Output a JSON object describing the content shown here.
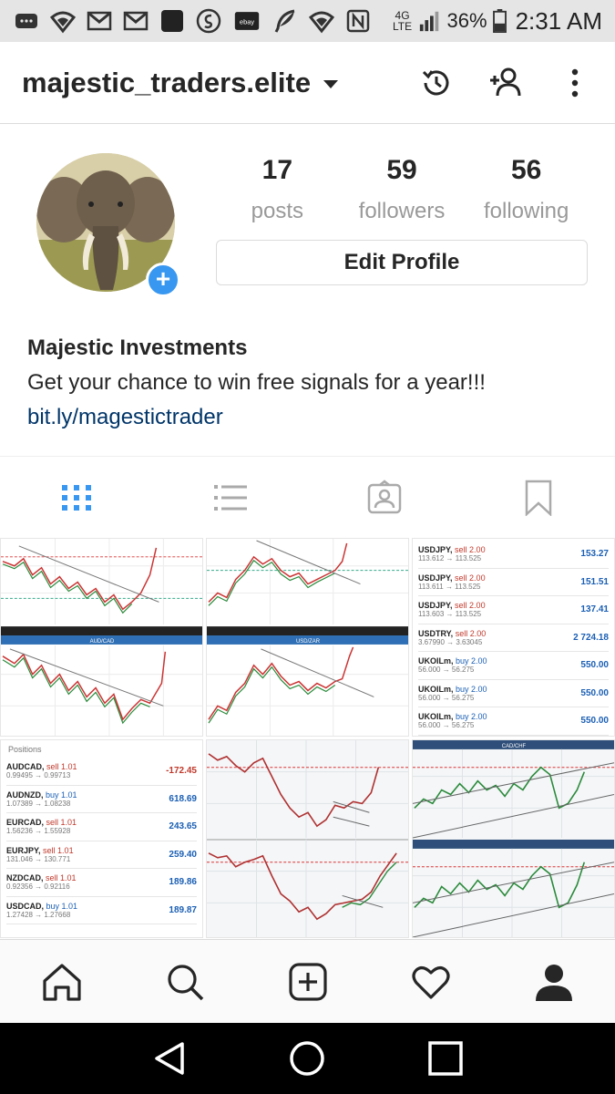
{
  "status_bar": {
    "left_icons": [
      "message-icon",
      "wifi-icon",
      "gmail-icon",
      "gmail-icon",
      "square-app-icon",
      "shazam-icon",
      "ebay-icon",
      "feather-icon",
      "wifi-icon",
      "nfc-icon"
    ],
    "ebay_label": "ebay",
    "network": "4G LTE",
    "battery": "36%",
    "time": "2:31 AM"
  },
  "header": {
    "username": "majestic_traders.elite",
    "icons": [
      "history-icon",
      "add-person-icon",
      "more-vertical-icon"
    ]
  },
  "profile": {
    "stats": [
      {
        "value": "17",
        "label": "posts"
      },
      {
        "value": "59",
        "label": "followers"
      },
      {
        "value": "56",
        "label": "following"
      }
    ],
    "edit_button": "Edit Profile",
    "bio_name": "Majestic Investments",
    "bio_text": "Get your chance to win free signals for a year!!!",
    "bio_link": "bit.ly/magestictrader"
  },
  "tabs": [
    "grid-icon",
    "list-icon",
    "tagged-icon",
    "bookmark-icon"
  ],
  "posts": {
    "trades_top": [
      {
        "sym": "USDJPY,",
        "act": "sell 2.00",
        "side": "sell",
        "px": "113.612 → 113.525",
        "val": "153.27"
      },
      {
        "sym": "USDJPY,",
        "act": "sell 2.00",
        "side": "sell",
        "px": "113.611 → 113.525",
        "val": "151.51"
      },
      {
        "sym": "USDJPY,",
        "act": "sell 2.00",
        "side": "sell",
        "px": "113.603 → 113.525",
        "val": "137.41"
      },
      {
        "sym": "USDTRY,",
        "act": "sell 2.00",
        "side": "sell",
        "px": "3.67990 → 3.63045",
        "val": "2 724.18"
      },
      {
        "sym": "UKOILm,",
        "act": "buy 2.00",
        "side": "buy",
        "px": "56.000 → 56.275",
        "val": "550.00"
      },
      {
        "sym": "UKOILm,",
        "act": "buy 2.00",
        "side": "buy",
        "px": "56.000 → 56.275",
        "val": "550.00"
      },
      {
        "sym": "UKOILm,",
        "act": "buy 2.00",
        "side": "buy",
        "px": "56.000 → 56.275",
        "val": "550.00"
      }
    ],
    "positions_header": "Positions",
    "trades_positions": [
      {
        "sym": "AUDCAD,",
        "act": "sell 1.01",
        "side": "sell",
        "px": "0.99495 → 0.99713",
        "val": "-172.45",
        "neg": true
      },
      {
        "sym": "AUDNZD,",
        "act": "buy 1.01",
        "side": "buy",
        "px": "1.07389 → 1.08238",
        "val": "618.69",
        "neg": false
      },
      {
        "sym": "EURCAD,",
        "act": "sell 1.01",
        "side": "sell",
        "px": "1.56236 → 1.55928",
        "val": "243.65",
        "neg": false
      },
      {
        "sym": "EURJPY,",
        "act": "sell 1.01",
        "side": "sell",
        "px": "131.046 → 130.771",
        "val": "259.40",
        "neg": false
      },
      {
        "sym": "NZDCAD,",
        "act": "sell 1.01",
        "side": "sell",
        "px": "0.92356 → 0.92116",
        "val": "189.86",
        "neg": false
      },
      {
        "sym": "USDCAD,",
        "act": "buy 1.01",
        "side": "buy",
        "px": "1.27428 → 1.27668",
        "val": "189.87",
        "neg": false
      }
    ],
    "chart_labels": {
      "audcad": "AUD/CAD",
      "usdzar": "USD/ZAR",
      "cadchf": "CAD/CHF"
    }
  },
  "bottom_nav": [
    "home-icon",
    "search-icon",
    "add-post-icon",
    "activity-heart-icon",
    "profile-icon"
  ],
  "android_nav": [
    "back-icon",
    "home-circle-icon",
    "recents-icon"
  ],
  "colors": {
    "accent": "#3897f0",
    "link": "#003569",
    "grid_tab": "#3897f0"
  }
}
